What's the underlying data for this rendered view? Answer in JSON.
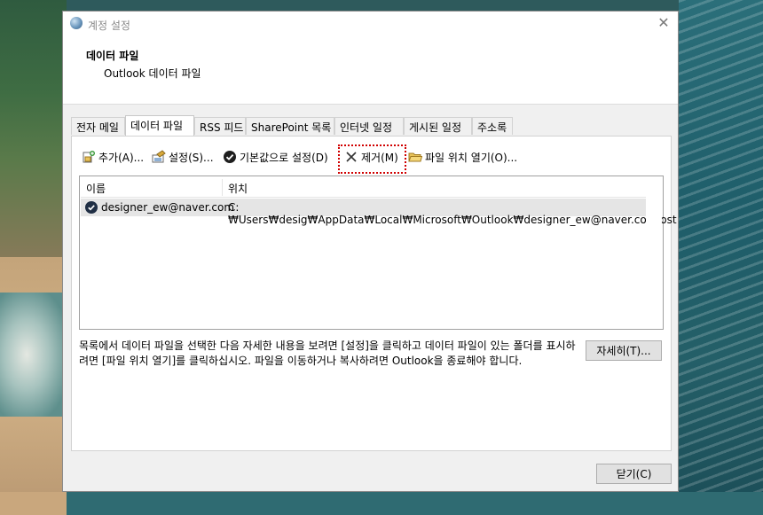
{
  "window": {
    "title": "계정 설정",
    "close_glyph": "✕"
  },
  "header": {
    "title": "데이터 파일",
    "subtitle": "Outlook 데이터 파일"
  },
  "tabs": [
    {
      "label": "전자 메일"
    },
    {
      "label": "데이터 파일"
    },
    {
      "label": "RSS 피드"
    },
    {
      "label": "SharePoint 목록"
    },
    {
      "label": "인터넷 일정"
    },
    {
      "label": "게시된 일정"
    },
    {
      "label": "주소록"
    }
  ],
  "active_tab": "데이터 파일",
  "toolbar": {
    "add_label": "추가(A)...",
    "settings_label": "설정(S)...",
    "set_default_label": "기본값으로 설정(D)",
    "remove_label": "제거(M)",
    "open_location_label": "파일 위치 열기(O)..."
  },
  "list": {
    "columns": {
      "name": "이름",
      "location": "위치"
    },
    "rows": [
      {
        "name": "designer_ew@naver.com",
        "location": "C:₩Users₩desig₩AppData₩Local₩Microsoft₩Outlook₩designer_ew@naver.com.ost",
        "default": true
      }
    ]
  },
  "description": "목록에서 데이터 파일을 선택한 다음 자세한 내용을 보려면 [설정]을 클릭하고 데이터 파일이 있는 폴더를 표시하려면 [파일 위치 열기]를 클릭하십시오. 파일을 이동하거나 복사하려면 Outlook을 종료해야 합니다.",
  "buttons": {
    "details_label": "자세히(T)...",
    "close_label": "닫기(C)"
  },
  "colors": {
    "highlight": "#d00000",
    "selected_row": "#e5e5e5"
  }
}
